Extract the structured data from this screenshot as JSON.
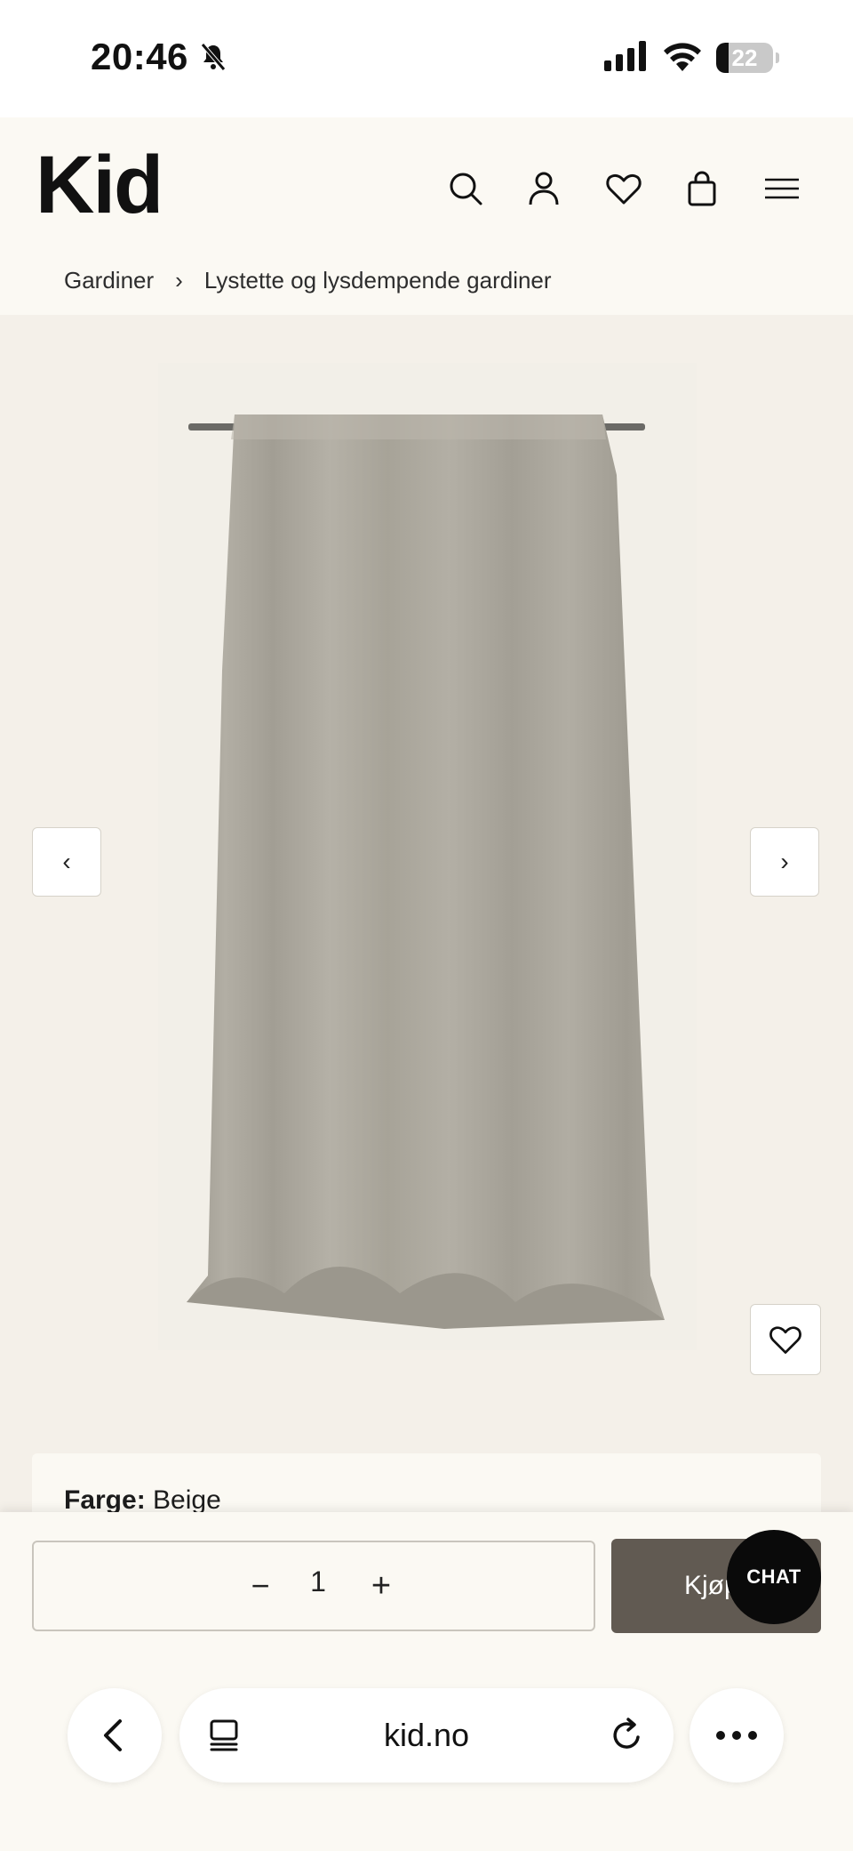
{
  "status_bar": {
    "time": "20:46",
    "battery_level": "22",
    "battery_fraction": 0.22
  },
  "header": {
    "logo": "Kid",
    "icons": [
      "search-icon",
      "user-icon",
      "heart-icon",
      "bag-icon",
      "menu-icon"
    ]
  },
  "breadcrumb": {
    "items": [
      "Gardiner",
      "Lystette og lysdempende gardiner"
    ],
    "separator": "›"
  },
  "gallery": {
    "prev_label": "‹",
    "next_label": "›",
    "image_color": "#a9a59b"
  },
  "product": {
    "color_label": "Farge:",
    "color_value": "Beige"
  },
  "purchase": {
    "qty_minus": "−",
    "quantity": "1",
    "qty_plus": "+",
    "buy_label": "Kjøp",
    "chat_label": "CHAT",
    "buy_color": "#615a52"
  },
  "browser": {
    "url": "kid.no"
  }
}
